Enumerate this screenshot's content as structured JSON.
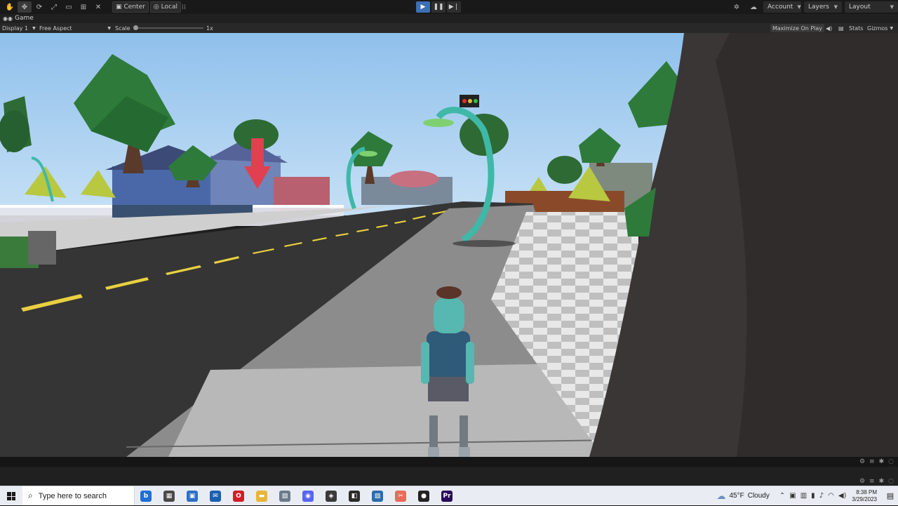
{
  "toolbar": {
    "pivot_label": "Center",
    "space_label": "Local",
    "account_label": "Account",
    "layers_label": "Layers",
    "layout_label": "Layout"
  },
  "game_view": {
    "tab_label": "Game",
    "display_label": "Display 1",
    "aspect_label": "Free Aspect",
    "scale_label": "Scale",
    "scale_value": "1x",
    "maximize_label": "Maximize On Play",
    "stats_label": "Stats",
    "gizmos_label": "Gizmos"
  },
  "taskbar": {
    "search_placeholder": "Type here to search",
    "weather_temp": "45°F",
    "weather_desc": "Cloudy",
    "time": "8:38 PM",
    "date": "3/29/2023",
    "apps": [
      {
        "icon": "bing-icon",
        "color": "#1f6fd6",
        "glyph": "b"
      },
      {
        "icon": "task-view-icon",
        "color": "#4a4a4a",
        "glyph": "▦"
      },
      {
        "icon": "store-icon",
        "color": "#2f6fc9",
        "glyph": "▣"
      },
      {
        "icon": "mail-icon",
        "color": "#1b5fb3",
        "glyph": "✉"
      },
      {
        "icon": "opera-icon",
        "color": "#d21f26",
        "glyph": "O"
      },
      {
        "icon": "file-explorer-icon",
        "color": "#e8b53a",
        "glyph": "▬"
      },
      {
        "icon": "photos-icon",
        "color": "#6b7b8b",
        "glyph": "▧"
      },
      {
        "icon": "discord-icon",
        "color": "#5865f2",
        "glyph": "◉"
      },
      {
        "icon": "unity-icon",
        "color": "#3a3a3a",
        "glyph": "◈"
      },
      {
        "icon": "visual-studio-icon",
        "color": "#2b2b2b",
        "glyph": "◧"
      },
      {
        "icon": "image-editor-icon",
        "color": "#2b6cb0",
        "glyph": "▨"
      },
      {
        "icon": "snipping-tool-icon",
        "color": "#e86b5b",
        "glyph": "✂"
      },
      {
        "icon": "record-icon",
        "color": "#222222",
        "glyph": "●"
      },
      {
        "icon": "premiere-icon",
        "color": "#2a0a5a",
        "glyph": "Pr"
      }
    ]
  },
  "colors": {
    "sky": "#97c6ee",
    "road": "#333333",
    "sidewalk": "#8a8a8a",
    "play_active": "#3d6fb3"
  }
}
